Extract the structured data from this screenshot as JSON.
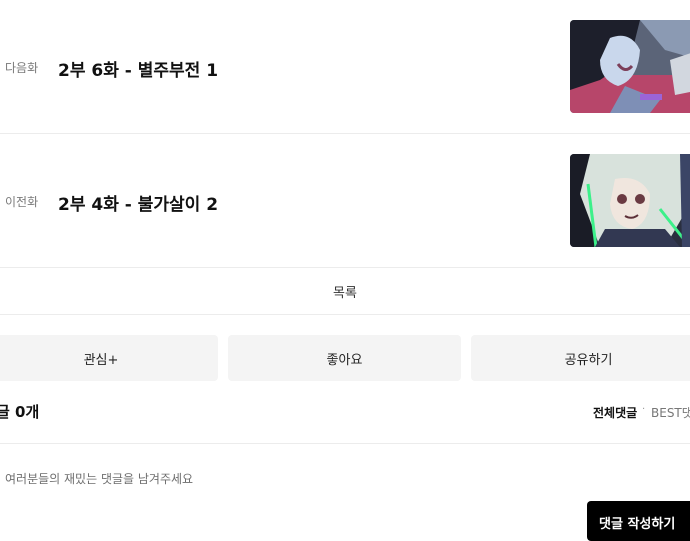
{
  "episodes": {
    "next": {
      "tag": "다음화",
      "title": "2부 6화 - 별주부전 1",
      "thumbnail_icon": "episode-thumbnail-next"
    },
    "prev": {
      "tag": "이전화",
      "title": "2부 4화 - 불가살이 2",
      "thumbnail_icon": "episode-thumbnail-prev"
    }
  },
  "list_button": {
    "label": "목록"
  },
  "actions": {
    "interest": "관심+",
    "like": "좋아요",
    "share": "공유하기"
  },
  "comments": {
    "count_label": "글 0개",
    "sort_all": "전체댓글",
    "sort_separator": "·",
    "sort_best": "BEST댓",
    "placeholder": "여러분들의 재밌는 댓글을 남겨주세요",
    "submit_label": "댓글 작성하기"
  },
  "colors": {
    "accent_black": "#000000",
    "button_bg": "#f4f4f4",
    "divider": "#ececec"
  }
}
